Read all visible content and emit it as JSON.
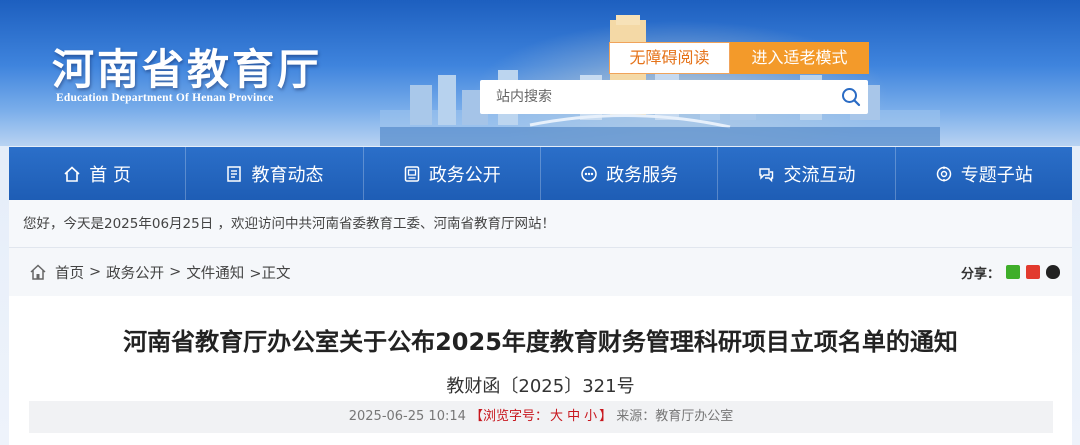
{
  "site": {
    "name_cn": "河南省教育厅",
    "name_en": "Education Department Of Henan Province"
  },
  "header": {
    "accessible_label": "无障碍阅读",
    "elder_mode_label": "进入适老模式",
    "search_placeholder": "站内搜索",
    "colors": {
      "accent_orange": "#f39a2a",
      "brand_blue": "#1e5db5"
    }
  },
  "nav": {
    "items": [
      {
        "label": "首 页",
        "icon": "home-icon"
      },
      {
        "label": "教育动态",
        "icon": "news-icon"
      },
      {
        "label": "政务公开",
        "icon": "document-icon"
      },
      {
        "label": "政务服务",
        "icon": "service-icon"
      },
      {
        "label": "交流互动",
        "icon": "interaction-icon"
      },
      {
        "label": "专题子站",
        "icon": "topic-icon"
      }
    ]
  },
  "welcome": {
    "text": "您好，今天是2025年06月25日 ，欢迎访问中共河南省委教育工委、河南省教育厅网站！"
  },
  "breadcrumb": {
    "items": [
      "首页",
      "政务公开",
      "文件通知"
    ],
    "separator": ">",
    "current": ">正文"
  },
  "share": {
    "label": "分享：",
    "icons": [
      "wechat-icon",
      "weibo-icon",
      "qq-icon"
    ]
  },
  "article": {
    "title": "河南省教育厅办公室关于公布2025年度教育财务管理科研项目立项名单的通知",
    "doc_number": "教财函〔2025〕321号",
    "meta": {
      "datetime": "2025-06-25 10:14",
      "font_size_prefix": "【浏览字号：",
      "size_large": "大",
      "size_medium": "中",
      "size_small": "小",
      "font_size_suffix": "】",
      "source": "来源：教育厅办公室"
    }
  }
}
